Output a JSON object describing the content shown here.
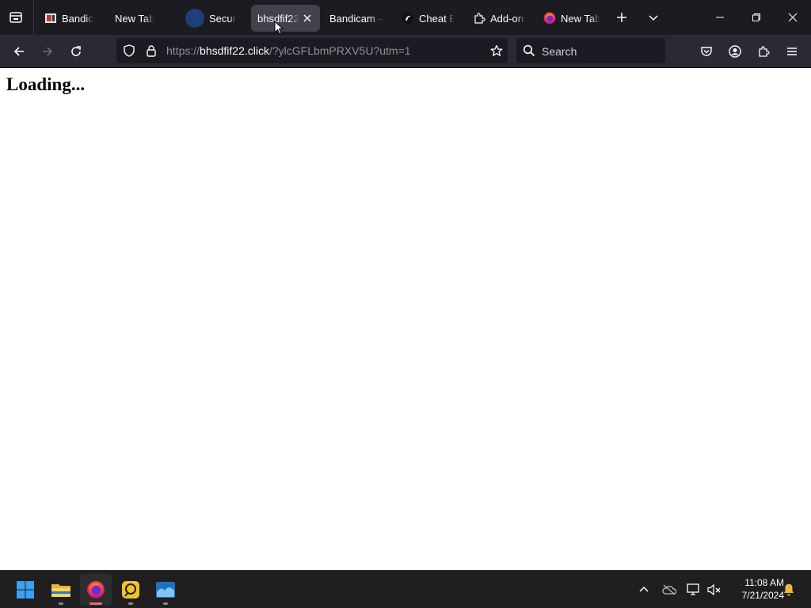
{
  "tabs": [
    {
      "title": "Bandicam",
      "icon": "bandicam-favicon",
      "active": false
    },
    {
      "title": "New Tab",
      "icon": "none",
      "active": false
    },
    {
      "title": "Secure D",
      "icon": "blue-circle-favicon",
      "active": false
    },
    {
      "title": "bhsdfif22",
      "icon": "none",
      "active": true
    },
    {
      "title": "Bandicam – ",
      "icon": "none",
      "active": false
    },
    {
      "title": "Cheat En",
      "icon": "cheat-engine-favicon",
      "active": false
    },
    {
      "title": "Add-ons",
      "icon": "puzzle-icon",
      "active": false
    },
    {
      "title": "New Tab",
      "icon": "firefox-favicon",
      "active": false
    }
  ],
  "urlbar": {
    "scheme": "https://",
    "domain": "bhsdfif22.click",
    "path": "/?ylcGFLbmPRXV5U?utm=1"
  },
  "search": {
    "placeholder": "Search"
  },
  "page": {
    "heading": "Loading..."
  },
  "taskbar": {
    "apps": [
      "windows-start",
      "file-explorer",
      "firefox",
      "bandicam",
      "ocean-app"
    ],
    "clock_time": "11:08 AM",
    "clock_date": "7/21/2024"
  },
  "colors": {
    "tabstrip_bg": "#1c1b22",
    "navbar_bg": "#2b2a33",
    "active_tab_bg": "#42414d",
    "taskbar_bg": "#1f1f1f",
    "notification_bell": "#e8b84a"
  }
}
